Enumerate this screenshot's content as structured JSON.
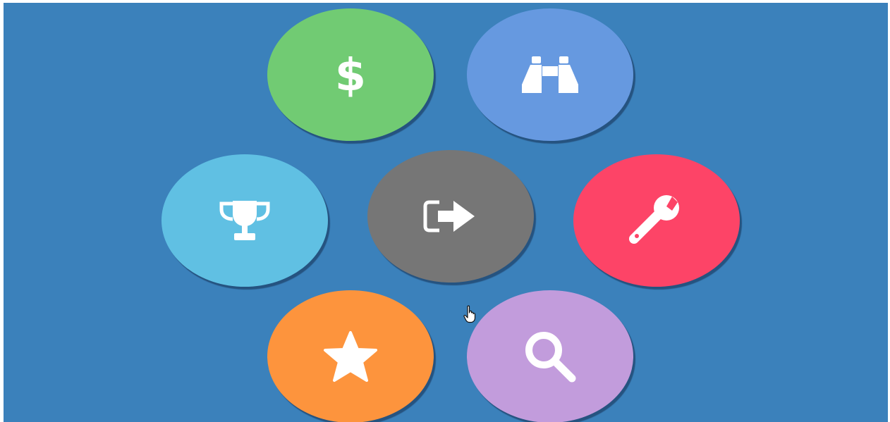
{
  "colors": {
    "background": "#3b81bb",
    "money": "#71cb73",
    "binoculars": "#6699e0",
    "trophy": "#60c0e3",
    "logout": "#767676",
    "wrench": "#fd4467",
    "star": "#fd943d",
    "search": "#c29cdc",
    "icon": "#ffffff"
  },
  "menu": {
    "items": [
      {
        "name": "money",
        "icon": "dollar-icon"
      },
      {
        "name": "binoculars",
        "icon": "binoculars-icon"
      },
      {
        "name": "trophy",
        "icon": "trophy-icon"
      },
      {
        "name": "logout",
        "icon": "sign-out-icon",
        "center": true
      },
      {
        "name": "wrench",
        "icon": "wrench-icon"
      },
      {
        "name": "star",
        "icon": "star-icon"
      },
      {
        "name": "search",
        "icon": "search-icon"
      }
    ]
  },
  "cursor": {
    "icon": "hand-pointer-icon"
  }
}
